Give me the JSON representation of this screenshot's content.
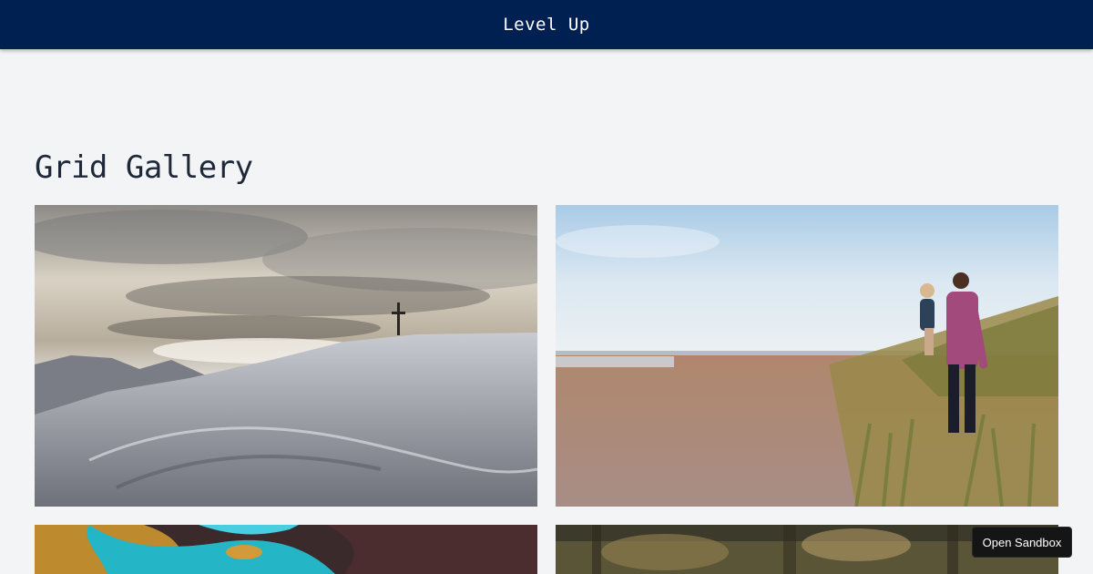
{
  "header": {
    "brand": "Level Up",
    "background_color": "#002052"
  },
  "main": {
    "title": "Grid Gallery"
  },
  "gallery": {
    "images": [
      {
        "subject": "snowy mountain summit with cross under cloudy sky"
      },
      {
        "subject": "man carrying child on sandy beach"
      },
      {
        "subject": "aerial view of turquoise coastline"
      },
      {
        "subject": "blurred forest scene"
      }
    ]
  },
  "sandbox": {
    "label": "Open Sandbox"
  },
  "colors": {
    "page_background": "#f3f4f6",
    "title_text": "#1e2838",
    "sandbox_button": "#151515"
  }
}
